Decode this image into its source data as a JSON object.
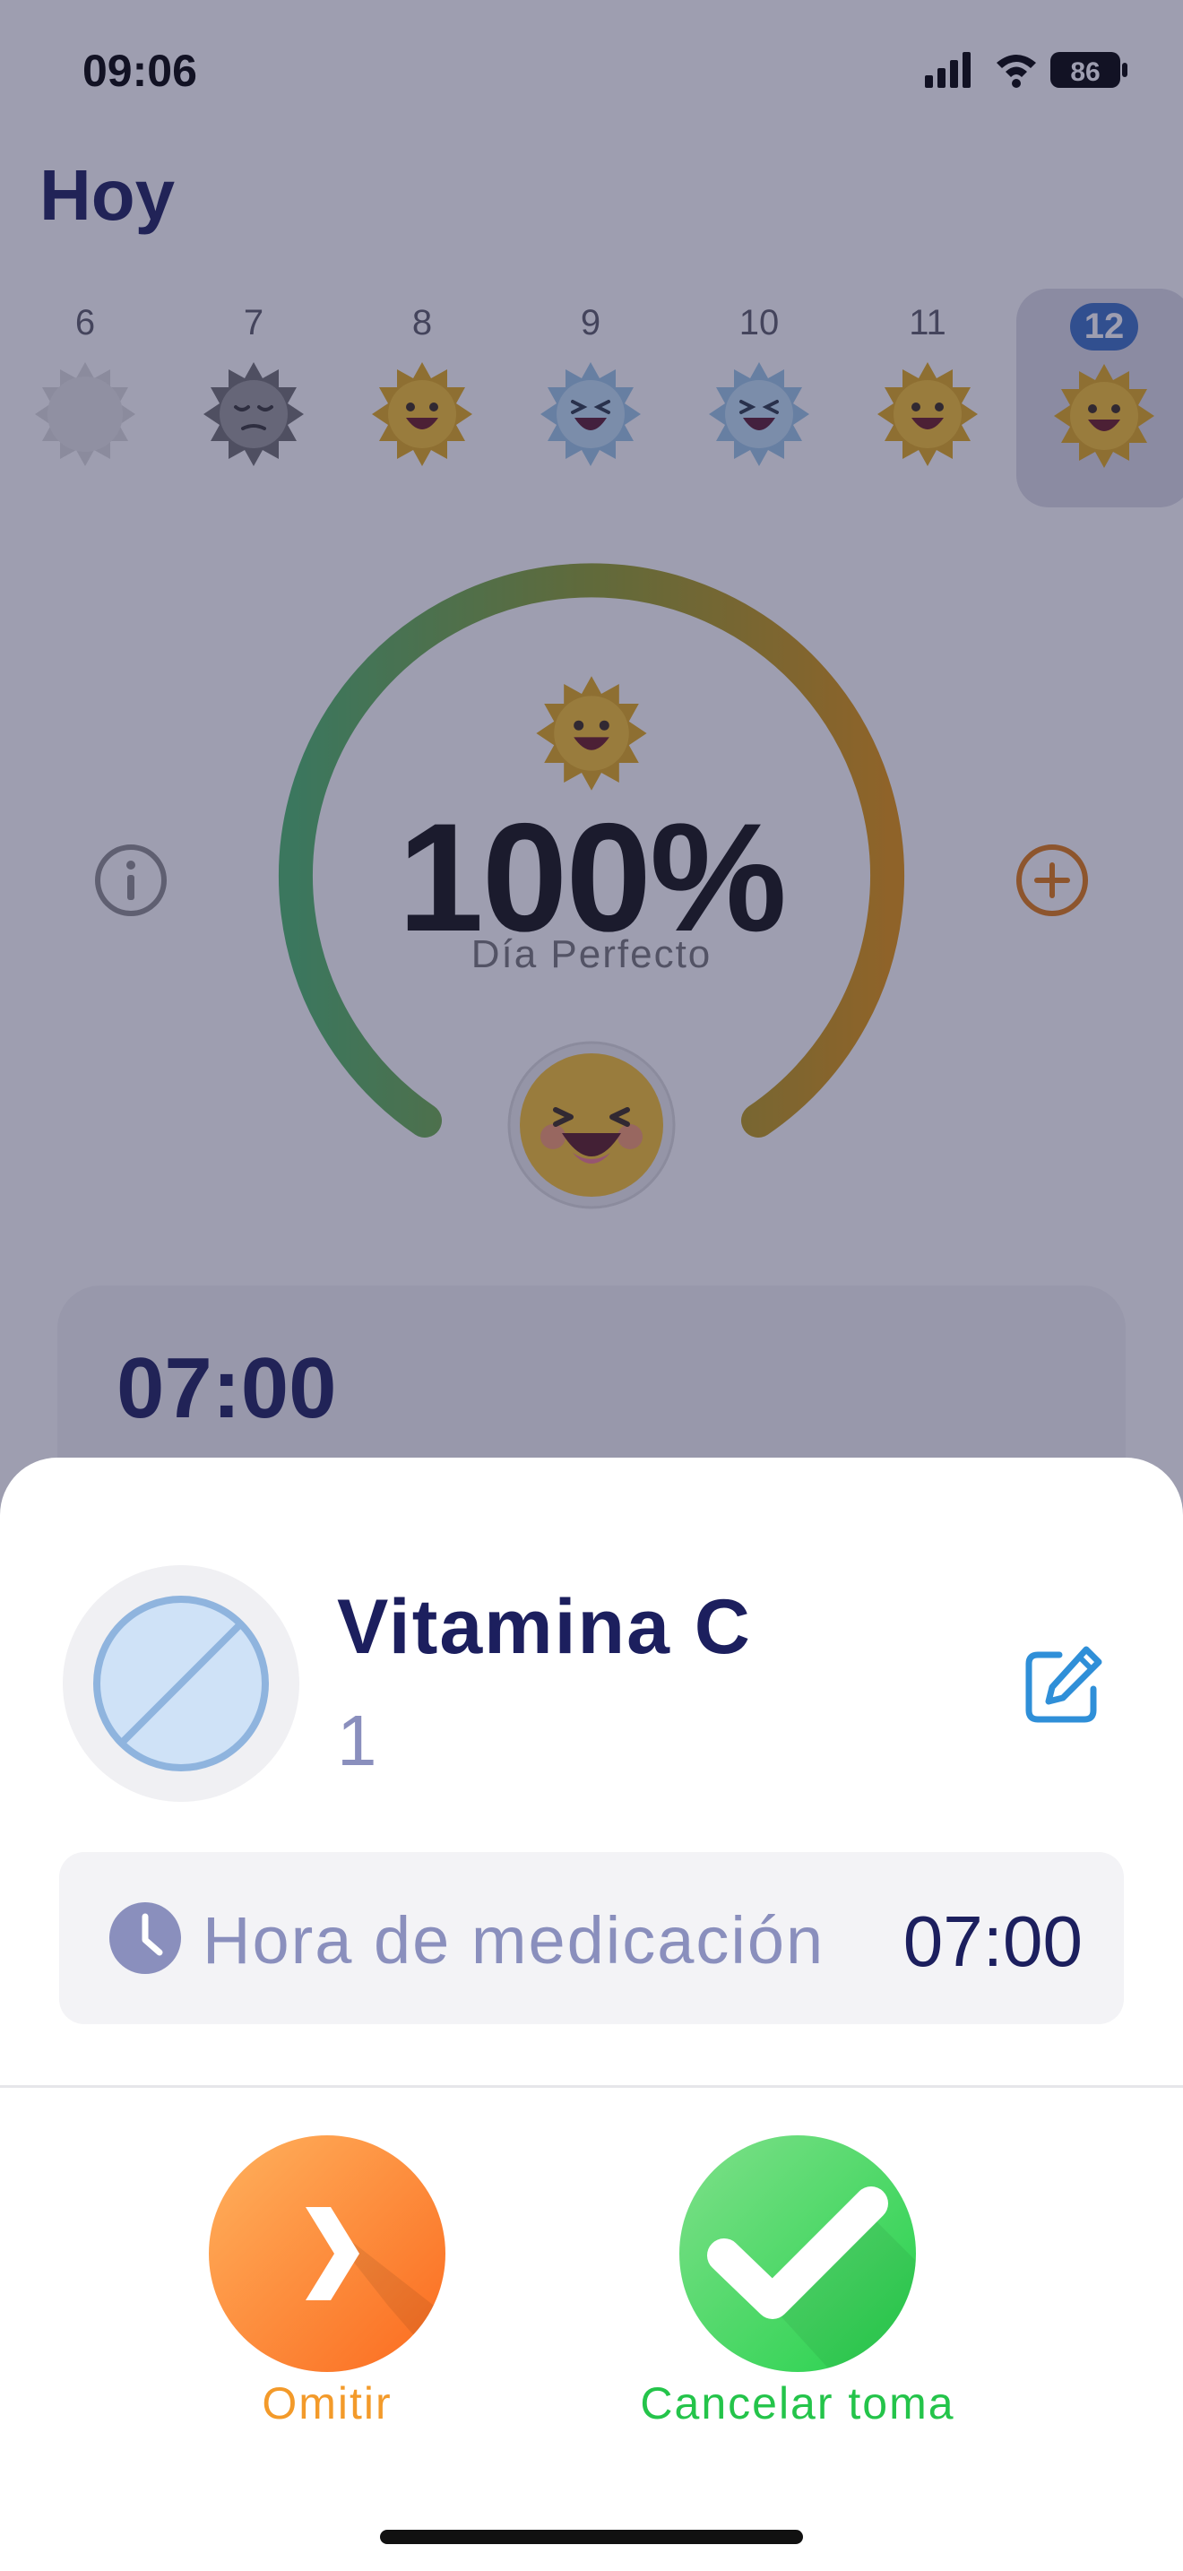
{
  "status_bar": {
    "time": "09:06",
    "battery": "86"
  },
  "header": {
    "title": "Hoy"
  },
  "days": [
    {
      "label": "6",
      "mood": "empty",
      "selected": false
    },
    {
      "label": "7",
      "mood": "sad",
      "selected": false
    },
    {
      "label": "8",
      "mood": "happy",
      "selected": false
    },
    {
      "label": "9",
      "mood": "laughing",
      "selected": false
    },
    {
      "label": "10",
      "mood": "laughing",
      "selected": false
    },
    {
      "label": "11",
      "mood": "happy",
      "selected": false
    },
    {
      "label": "12",
      "mood": "happy",
      "selected": true
    }
  ],
  "summary": {
    "percent": "100%",
    "label": "Día Perfecto",
    "progress": 1.0
  },
  "colors": {
    "gauge_start": "#4cb86a",
    "gauge_mid": "#8fa02a",
    "gauge_end": "#e3940a",
    "accent_orange": "#f39a2a",
    "accent_green": "#24c44a",
    "navy": "#1c1f5e"
  },
  "dose_card": {
    "time": "07:00"
  },
  "sheet": {
    "medication_name": "Vitamina C",
    "dose": "1",
    "time_label": "Hora de medicación",
    "time_value": "07:00",
    "skip_label": "Omitir",
    "confirm_label": "Cancelar toma"
  },
  "icons": {
    "info": "info-icon",
    "add": "plus-icon",
    "edit": "edit-icon",
    "clock": "clock-icon",
    "skip": "chevron-right-icon",
    "confirm": "checkmark-icon",
    "pill": "pill-icon"
  }
}
